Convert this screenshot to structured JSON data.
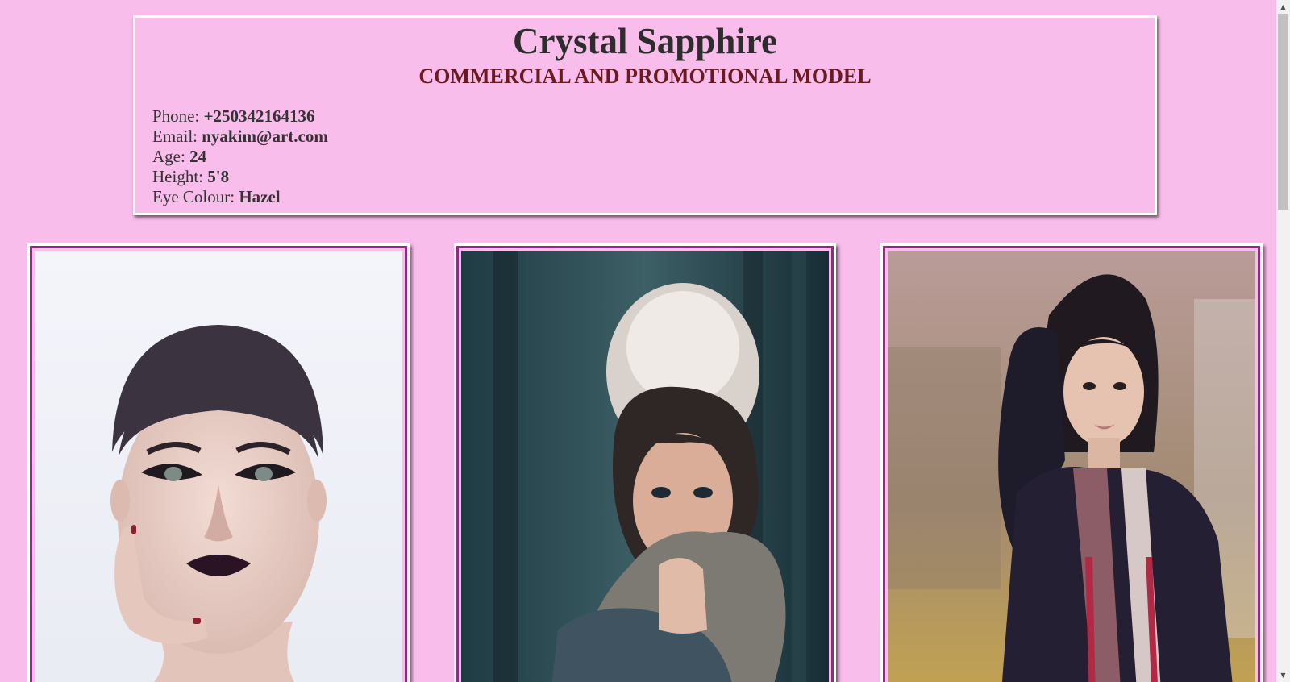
{
  "profile": {
    "name": "Crystal Sapphire",
    "subtitle": "COMMERCIAL AND PROMOTIONAL MODEL",
    "details": [
      {
        "label": "Phone: ",
        "value": "+250342164136"
      },
      {
        "label": "Email: ",
        "value": "nyakim@art.com"
      },
      {
        "label": "Age: ",
        "value": "24"
      },
      {
        "label": "Height: ",
        "value": "5'8"
      },
      {
        "label": "Eye Colour: ",
        "value": "Hazel"
      }
    ]
  },
  "gallery": [
    {
      "subject": "studio portrait, dark makeup, hand on cheek"
    },
    {
      "subject": "woman in fur-trimmed winter hood"
    },
    {
      "subject": "woman in dark knit sweater and patterned scarf"
    }
  ],
  "colors": {
    "page_background": "#f9bdec",
    "frame_outline": "#8e2b87",
    "subtitle": "#6b1a20"
  },
  "scrollbar": {
    "up_icon": "triangle-up-icon",
    "down_icon": "triangle-down-icon"
  }
}
